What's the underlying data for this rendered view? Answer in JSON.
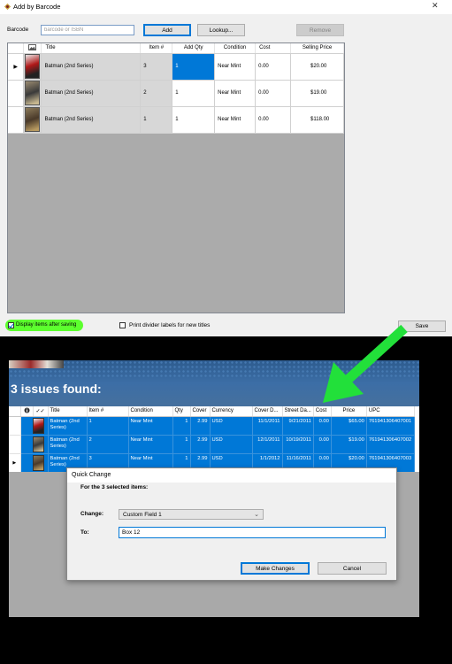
{
  "window1": {
    "title": "Add by Barcode",
    "close_glyph": "✕",
    "barcode_label": "Barcode",
    "barcode_placeholder": "barcode or ISBN",
    "add_label": "Add",
    "lookup_label": "Lookup...",
    "remove_label": "Remove",
    "columns": [
      "Title",
      "Item #",
      "Add Qty",
      "Condition",
      "Cost",
      "Selling Price"
    ],
    "rows": [
      {
        "title": "Batman (2nd Series)",
        "item": "3",
        "add_qty": "1",
        "condition": "Near Mint",
        "cost": "0.00",
        "selling_price": "$20.00",
        "current": true
      },
      {
        "title": "Batman (2nd Series)",
        "item": "2",
        "add_qty": "1",
        "condition": "Near Mint",
        "cost": "0.00",
        "selling_price": "$19.00",
        "current": false
      },
      {
        "title": "Batman (2nd Series)",
        "item": "1",
        "add_qty": "1",
        "condition": "Near Mint",
        "cost": "0.00",
        "selling_price": "$118.00",
        "current": false
      }
    ],
    "display_items_label": "Display items after saving",
    "print_divider_label": "Print divider labels for new titles",
    "save_label": "Save"
  },
  "window2": {
    "heading": "3 issues found:",
    "columns": [
      "Title",
      "Item #",
      "Condition",
      "Qty",
      "Cover",
      "Currency",
      "Cover D...",
      "Street Da...",
      "Cost",
      "Price",
      "UPC"
    ],
    "rows": [
      {
        "title": "Batman (2nd Series)",
        "item": "1",
        "condition": "Near Mint",
        "qty": "1",
        "cover": "2.99",
        "currency": "USD",
        "cover_date": "11/1/2011",
        "street_date": "9/21/2011",
        "cost": "0.00",
        "price": "$65.00",
        "upc": "761941306407001"
      },
      {
        "title": "Batman (2nd Series)",
        "item": "2",
        "condition": "Near Mint",
        "qty": "1",
        "cover": "2.99",
        "currency": "USD",
        "cover_date": "12/1/2011",
        "street_date": "10/19/2011",
        "cost": "0.00",
        "price": "$19.00",
        "upc": "761941306407002"
      },
      {
        "title": "Batman (2nd Series)",
        "item": "3",
        "condition": "Near Mint",
        "qty": "1",
        "cover": "2.99",
        "currency": "USD",
        "cover_date": "1/1/2012",
        "street_date": "11/16/2011",
        "cost": "0.00",
        "price": "$20.00",
        "upc": "761941306407003"
      }
    ]
  },
  "quick_change": {
    "title": "Quick Change",
    "subtitle": "For the 3 selected items:",
    "change_label": "Change:",
    "change_value": "Custom Field 1",
    "to_label": "To:",
    "to_value": "Box 12",
    "make_changes_label": "Make Changes",
    "cancel_label": "Cancel"
  },
  "colors": {
    "selection_blue": "#0078d7",
    "highlight_green": "#5cff2e",
    "arrow_green": "#22e03a"
  },
  "icons": [
    "app-icon",
    "close-icon",
    "image-column-icon",
    "row-pointer-icon",
    "checkmark-icon",
    "info-icon",
    "chevron-down-icon",
    "green-arrow-annotation"
  ]
}
